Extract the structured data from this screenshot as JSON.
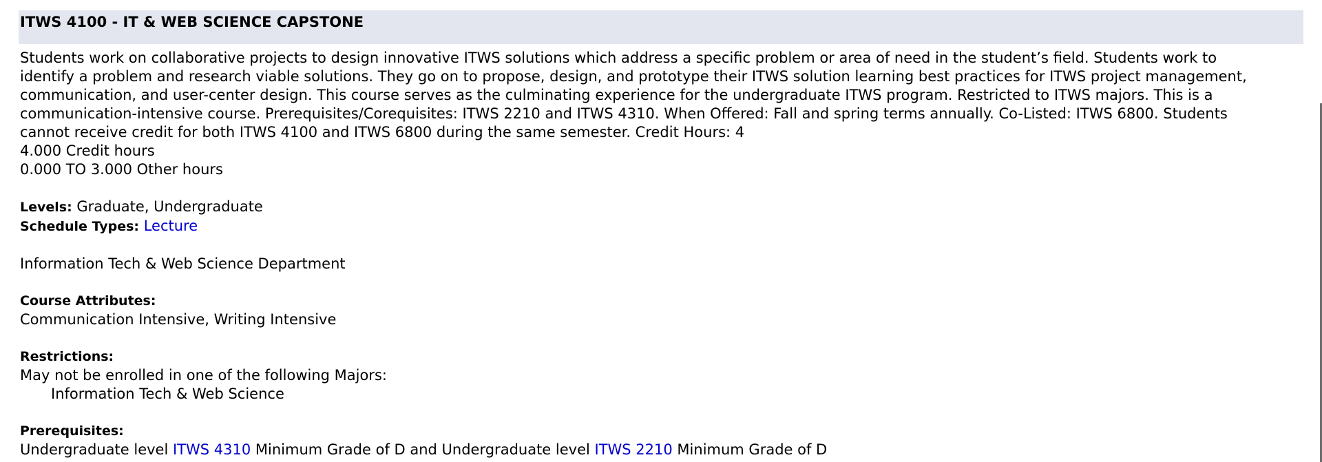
{
  "course": {
    "title": "ITWS 4100 - IT & WEB SCIENCE CAPSTONE",
    "desc_lines": [
      "Students work on collaborative projects to design innovative ITWS solutions which address a specific problem or area of need in the student’s field. Students work to",
      "identify a problem and research viable solutions. They go on to propose, design, and prototype their ITWS solution learning best practices for ITWS project management,",
      "communication, and user-center design. This course serves as the culminating experience for the undergraduate ITWS program. Restricted to ITWS majors. This is a",
      "communication-intensive course. Prerequisites/Corequisites: ITWS 2210 and ITWS 4310. When Offered: Fall and spring terms annually. Co-Listed: ITWS 6800. Students",
      "cannot receive credit for both ITWS 4100 and ITWS 6800 during the same semester. Credit Hours: 4"
    ],
    "credit_hours": "4.000 Credit hours",
    "other_hours": "0.000 TO 3.000 Other hours",
    "levels_label": "Levels:",
    "levels_value": "Graduate, Undergraduate",
    "schedule_label": "Schedule Types:",
    "schedule_value": "Lecture",
    "department": "Information Tech & Web Science Department",
    "attributes_label": "Course Attributes:",
    "attributes_value": "Communication Intensive, Writing Intensive",
    "restrictions_label": "Restrictions:",
    "restrictions_text": "May not be enrolled in one of the following Majors:",
    "restrictions_major": "Information Tech & Web Science",
    "prereq_label": "Prerequisites:",
    "prereq": {
      "part1": "Undergraduate level ",
      "link1": "ITWS 4310",
      "part2": " Minimum Grade of D and Undergraduate level ",
      "link2": "ITWS 2210",
      "part3": " Minimum Grade of D"
    }
  },
  "colors": {
    "header_bg": "#e3e6ef",
    "link": "#0000cc"
  }
}
